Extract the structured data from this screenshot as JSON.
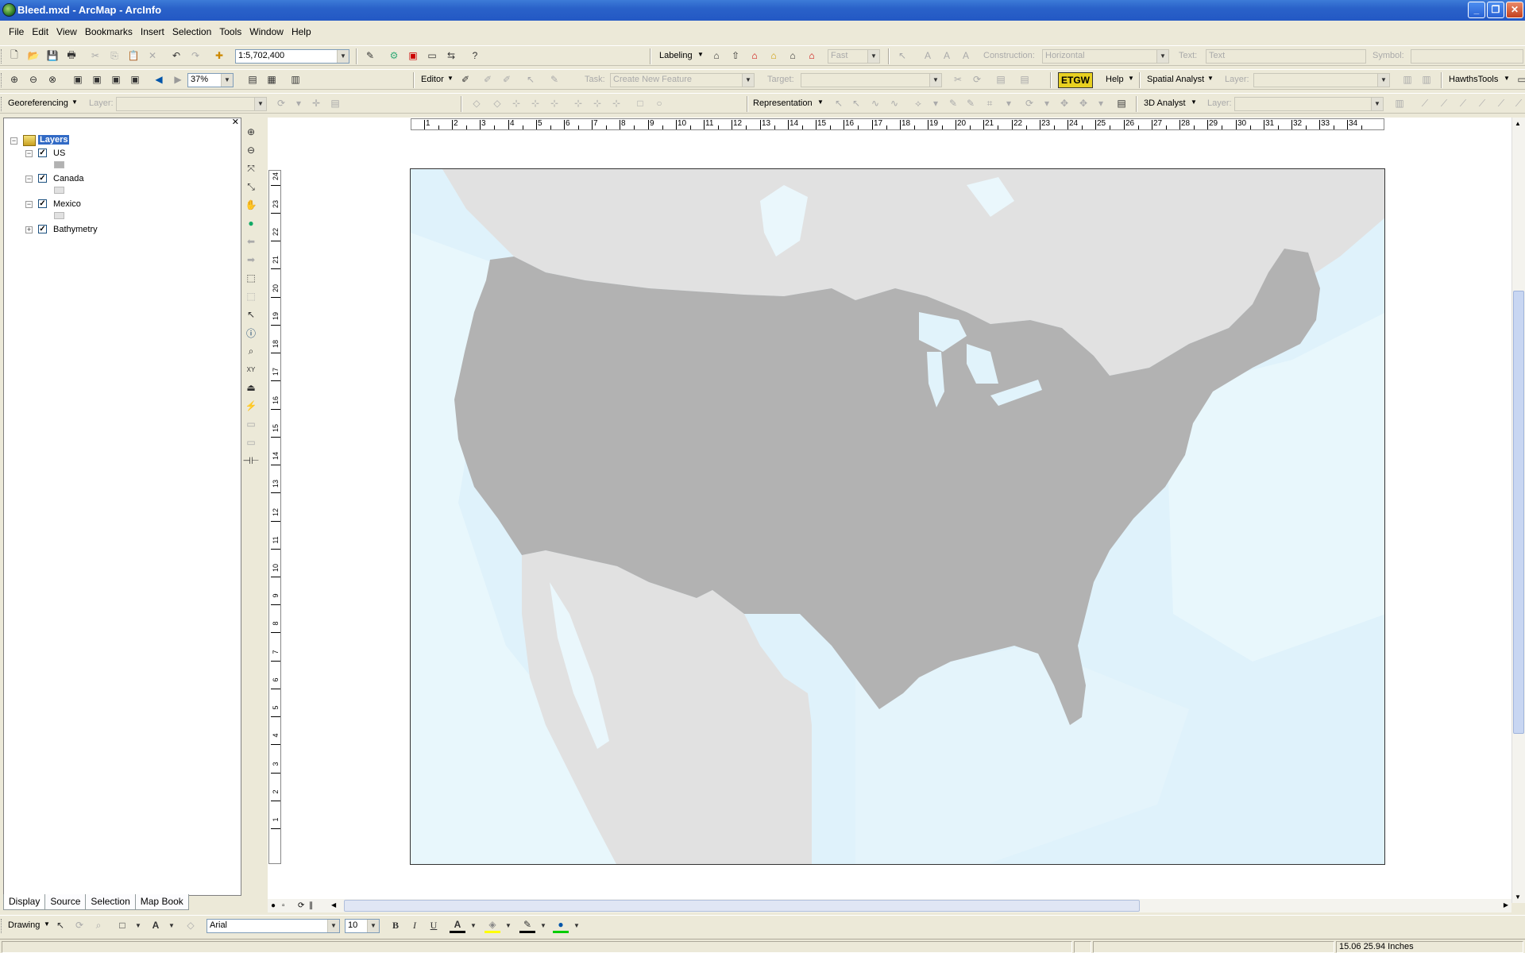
{
  "window": {
    "title": "Bleed.mxd - ArcMap - ArcInfo",
    "min": "_",
    "max": "❐",
    "close": "✕"
  },
  "menu": [
    "File",
    "Edit",
    "View",
    "Bookmarks",
    "Insert",
    "Selection",
    "Tools",
    "Window",
    "Help"
  ],
  "standard": {
    "scale": "1:5,702,400",
    "zoom": "37%"
  },
  "labeling": {
    "label": "Labeling",
    "fast": "Fast",
    "construction_label": "Construction:",
    "construction_value": "Horizontal",
    "text_label": "Text:",
    "text_value": "Text",
    "symbol_label": "Symbol:"
  },
  "editor": {
    "label": "Editor",
    "task_label": "Task:",
    "task_value": "Create New Feature",
    "target_label": "Target:"
  },
  "etgw": {
    "label": "ETGW",
    "help": "Help",
    "spatial_analyst": "Spatial Analyst",
    "layer_label": "Layer:",
    "hawths": "HawthsTools"
  },
  "georef": {
    "label": "Georeferencing",
    "layer_label": "Layer:"
  },
  "representation": {
    "label": "Representation"
  },
  "analyst3d": {
    "label": "3D Analyst",
    "layer_label": "Layer:"
  },
  "toc": {
    "root": "Layers",
    "layers": [
      {
        "name": "US",
        "checked": true,
        "expanded": true,
        "swatch": "#b2b2b2"
      },
      {
        "name": "Canada",
        "checked": true,
        "expanded": true,
        "swatch": "#e1e1e1"
      },
      {
        "name": "Mexico",
        "checked": true,
        "expanded": true,
        "swatch": "#e1e1e1"
      },
      {
        "name": "Bathymetry",
        "checked": true,
        "expanded": false
      }
    ],
    "tabs": [
      "Display",
      "Source",
      "Selection",
      "Map Book"
    ]
  },
  "ruler": {
    "h_ticks": [
      "1",
      "2",
      "3",
      "4",
      "5",
      "6",
      "7",
      "8",
      "9",
      "10",
      "11",
      "12",
      "13",
      "14",
      "15",
      "16",
      "17",
      "18",
      "19",
      "20",
      "21",
      "22",
      "23",
      "24",
      "25",
      "26",
      "27",
      "28",
      "29",
      "30",
      "31",
      "32",
      "33",
      "34"
    ],
    "v_ticks": [
      "24",
      "23",
      "22",
      "21",
      "20",
      "19",
      "18",
      "17",
      "16",
      "15",
      "14",
      "13",
      "12",
      "11",
      "10",
      "9",
      "8",
      "7",
      "6",
      "5",
      "4",
      "3",
      "2",
      "1"
    ]
  },
  "map": {
    "us_color": "#b2b2b2",
    "land_color": "#e1e1e1",
    "water_color": "#dff2fb"
  },
  "drawing": {
    "label": "Drawing",
    "font": "Arial",
    "size": "10",
    "bold": "B",
    "italic": "I",
    "underline": "U"
  },
  "status": {
    "coords": "15.06  25.94 Inches"
  }
}
